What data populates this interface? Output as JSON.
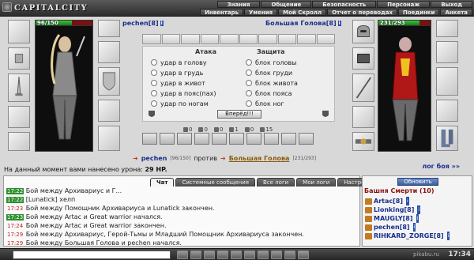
{
  "app": {
    "logo_text": "CAPITALCITY"
  },
  "menu": {
    "top": [
      "Знания",
      "Общение",
      "Безопасность",
      "Персонаж",
      "Выход"
    ],
    "bottom": [
      "Инвентарь",
      "Умения",
      "Мой Скролл",
      "Отчет о переводах",
      "Поединки",
      "Анкета"
    ]
  },
  "player": {
    "name": "pechen",
    "level": "[8]",
    "hp_text": "96/150",
    "hp_fraction": 0.64
  },
  "enemy": {
    "name": "Большая Голова",
    "level": "[8]",
    "hp_text": "231/293",
    "hp_fraction": 0.788
  },
  "attack": {
    "attack_header": "Атака",
    "defense_header": "Защита",
    "attack_options": [
      "удар в голову",
      "удар в грудь",
      "удар в живот",
      "удар в пояс(пах)",
      "удар по ногам"
    ],
    "defense_options": [
      "блок головы",
      "блок груди",
      "блок живота",
      "блок пояса",
      "блок ног"
    ],
    "go_label": "Вперёд!!!"
  },
  "stats": [
    "0",
    "0",
    "0",
    "1",
    "0",
    "15"
  ],
  "vs": {
    "player_name": "pechen",
    "player_hp": "[96/150]",
    "vs_word": "против",
    "enemy_name": "Большая Голова",
    "enemy_hp": "[231/293]"
  },
  "damage": {
    "prefix": "На данный момент вами нанесено урона:",
    "value": "29 HP."
  },
  "log_link": "лог боя »»",
  "chat_tabs": [
    "Чат",
    "Системные сообщения",
    "Все логи",
    "Мои логи",
    "Настройки"
  ],
  "chat_messages": [
    {
      "time": "17:22",
      "text": "Бой между Архивариус и Г..."
    },
    {
      "time": "17:22",
      "text": "[Lunatick] хелп"
    },
    {
      "time": "17:23",
      "text": "Бой между Помощник Архивариуса и Lunatick закончен."
    },
    {
      "time": "17:23",
      "text": "Бой между Artac и Great warrior начался."
    },
    {
      "time": "17:24",
      "text": "Бой между Artac и Great warrior закончен."
    },
    {
      "time": "17:29",
      "text": "Бой между Архивариус, Герой-Тьмы и Младший Помощник Архивариуса закончен."
    },
    {
      "time": "17:29",
      "text": "Бой между Большая Голова и pechen начался."
    }
  ],
  "side": {
    "refresh_label": "Обновить",
    "room_title": "Башня Смерти (10)",
    "users": [
      "Artac[8]",
      "Lionking[8]",
      "MAUGLY[8]",
      "pechen[8]",
      "RIHKARD_ZORGE[8]"
    ]
  },
  "footer": {
    "clock": "17:34",
    "tag": "pikabu.ru"
  },
  "colors": {
    "accent": "#1a2f8c",
    "hp_good": "#2f9f2f",
    "hp_bad": "#7a1010",
    "chrome": "#3a3a3a"
  }
}
